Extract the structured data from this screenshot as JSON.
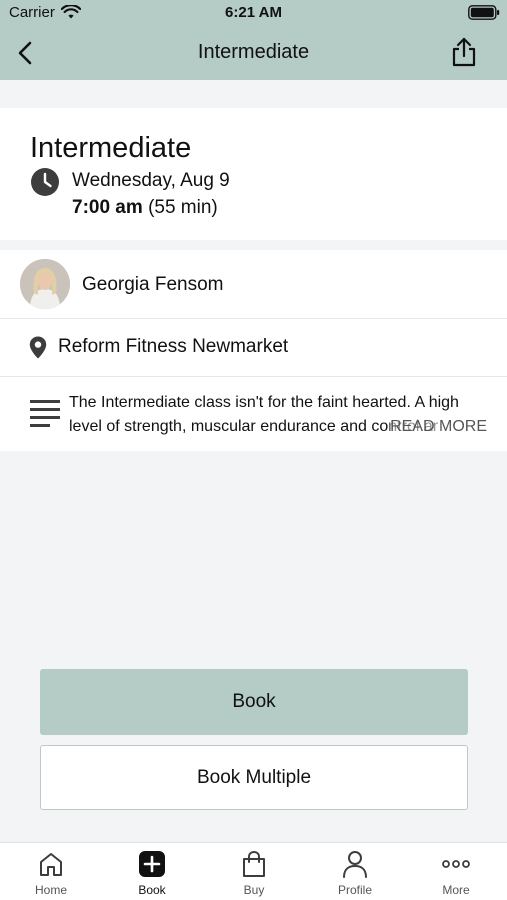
{
  "status_bar": {
    "carrier": "Carrier",
    "time": "6:21 AM"
  },
  "nav": {
    "title": "Intermediate",
    "back_icon": "chevron-left-icon",
    "share_icon": "share-icon"
  },
  "class_info": {
    "title": "Intermediate",
    "date": "Wednesday, Aug 9",
    "time": "7:00 am",
    "duration": "(55 min)"
  },
  "instructor": {
    "name": "Georgia Fensom"
  },
  "location": {
    "name": "Reform Fitness Newmarket"
  },
  "description": {
    "text": "The Intermediate class isn't for the faint hearted. A high level of strength, muscular endurance and control ar",
    "read_more": "READ MORE"
  },
  "actions": {
    "book_label": "Book",
    "book_multiple_label": "Book Multiple"
  },
  "tabs": [
    {
      "label": "Home",
      "icon": "home-icon",
      "active": false
    },
    {
      "label": "Book",
      "icon": "plus-square-icon",
      "active": true
    },
    {
      "label": "Buy",
      "icon": "shopping-bag-icon",
      "active": false
    },
    {
      "label": "Profile",
      "icon": "person-icon",
      "active": false
    },
    {
      "label": "More",
      "icon": "more-dots-icon",
      "active": false
    }
  ],
  "colors": {
    "accent": "#b4cbc6",
    "background": "#f2f4f5"
  }
}
